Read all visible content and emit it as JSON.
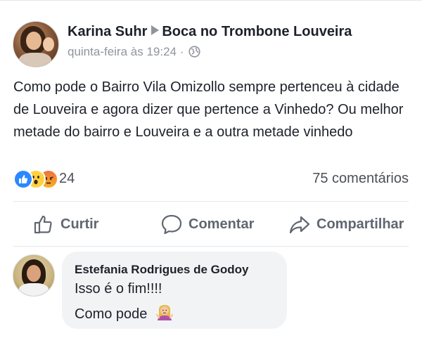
{
  "post": {
    "author": "Karina Suhr",
    "group": "Boca no Trombone Louveira",
    "timestamp": "quinta-feira às 19:24 ·",
    "audience_icon": "globe-icon",
    "text": "Como pode o Bairro Vila Omizollo sempre pertenceu à cidade de Louveira e agora dizer que  pertence a Vinhedo? Ou melhor metade do bairro e Louveira e a outra metade vinhedo"
  },
  "reactions": {
    "types": [
      "like",
      "wow",
      "angry"
    ],
    "count": "24",
    "comments": "75 comentários"
  },
  "actions": {
    "like_label": "Curtir",
    "comment_label": "Comentar",
    "share_label": "Compartilhar"
  },
  "comment": {
    "author": "Estefania Rodrigues de Godoy",
    "line1": "Isso é o fim!!!!",
    "line2": "Como pode",
    "emoji": "woman-shrugging-emoji"
  },
  "colors": {
    "like_blue": "#2d88ff",
    "wow_yellow": "#ffd23f",
    "angry_orange": "#f0713c",
    "meta_gray": "#90949c",
    "bubble_gray": "#f2f3f5"
  }
}
